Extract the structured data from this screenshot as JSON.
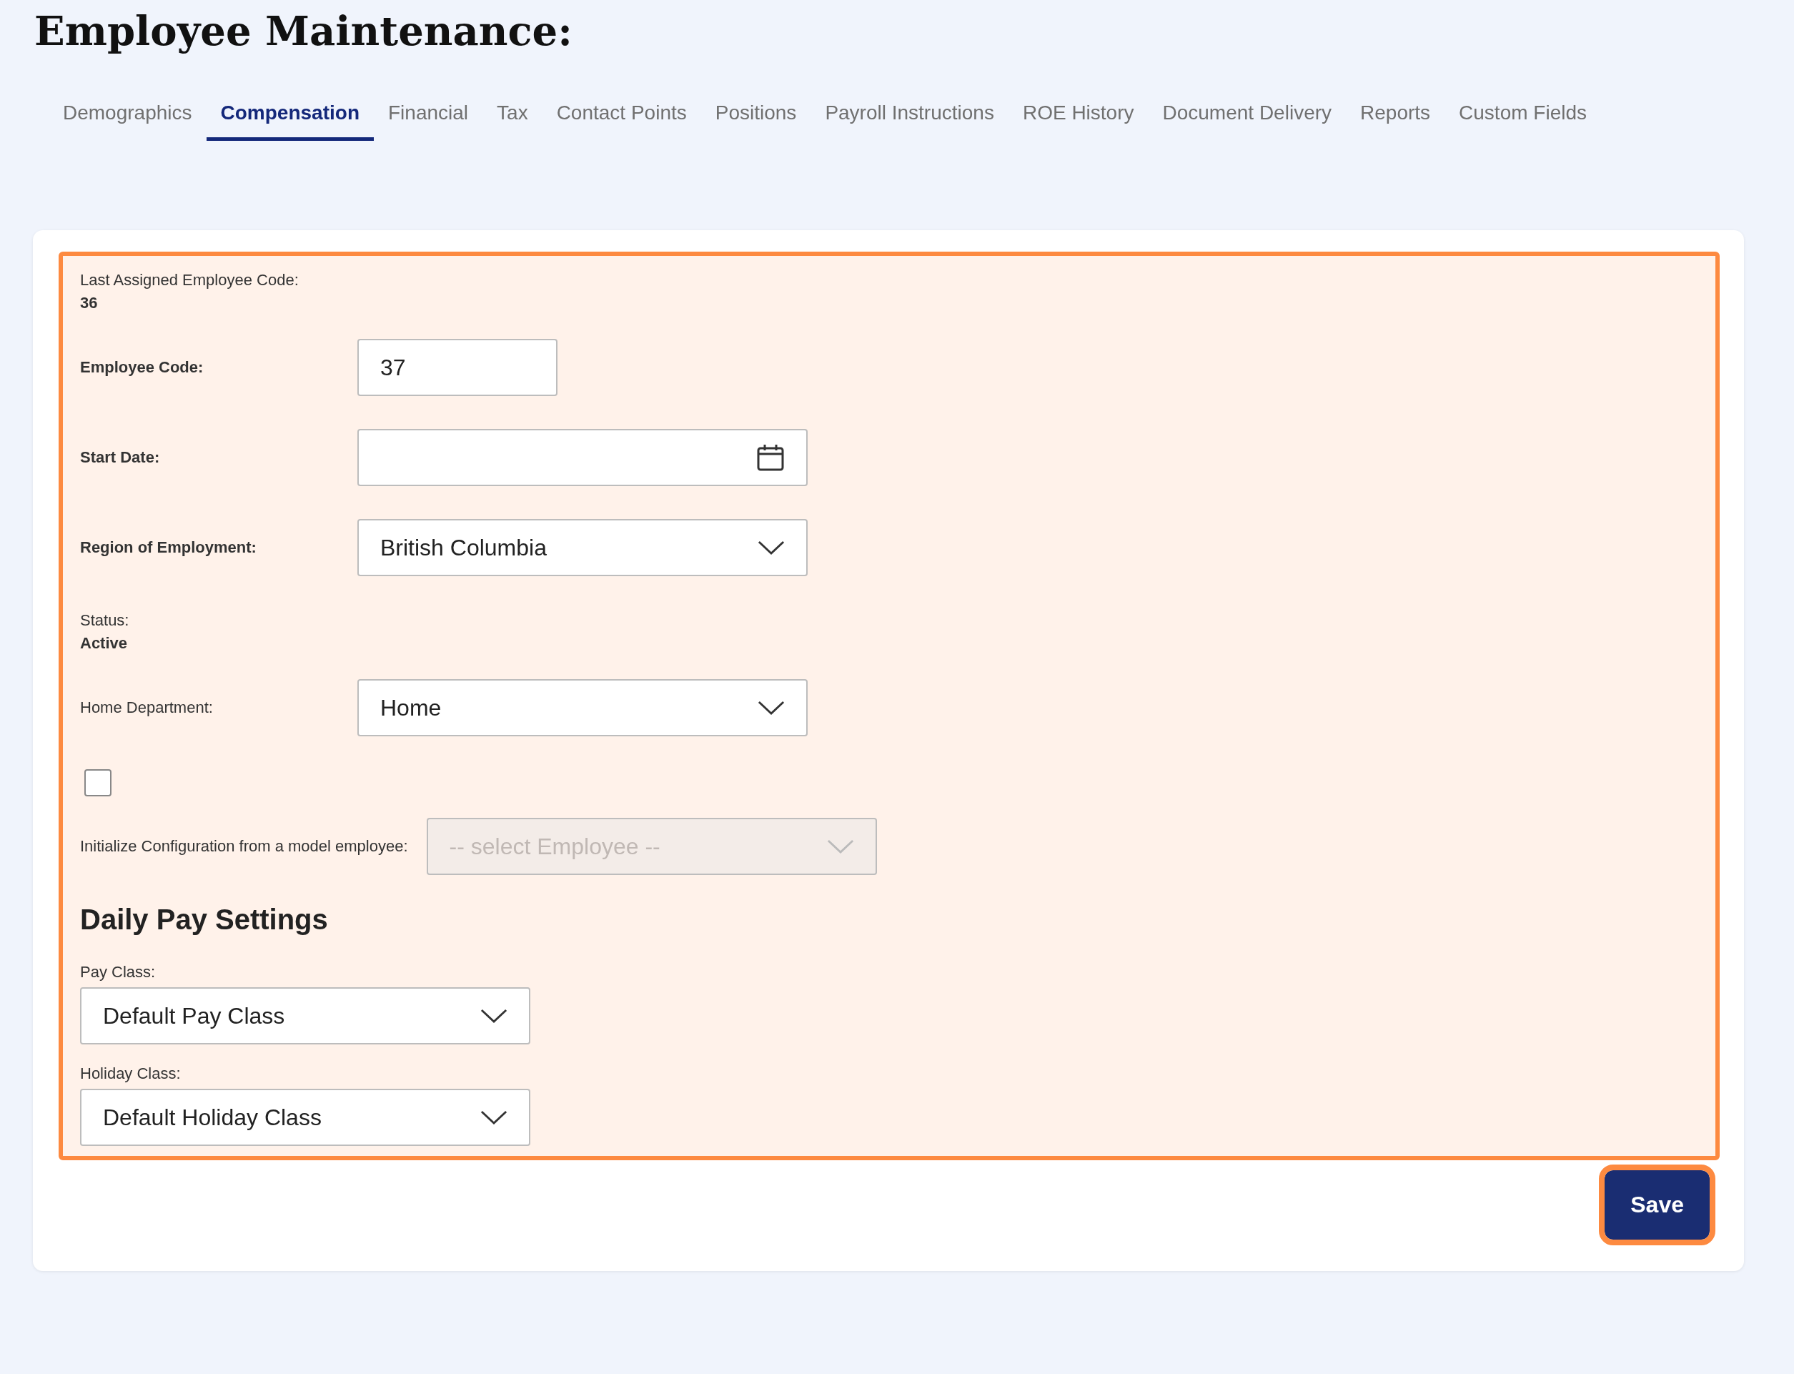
{
  "title": "Employee Maintenance:",
  "tabs": [
    {
      "label": "Demographics",
      "selected": false
    },
    {
      "label": "Compensation",
      "selected": true
    },
    {
      "label": "Financial",
      "selected": false
    },
    {
      "label": "Tax",
      "selected": false
    },
    {
      "label": "Contact Points",
      "selected": false
    },
    {
      "label": "Positions",
      "selected": false
    },
    {
      "label": "Payroll Instructions",
      "selected": false
    },
    {
      "label": "ROE History",
      "selected": false
    },
    {
      "label": "Document Delivery",
      "selected": false
    },
    {
      "label": "Reports",
      "selected": false
    },
    {
      "label": "Custom Fields",
      "selected": false
    }
  ],
  "form": {
    "highlighted": true,
    "fields": [
      {
        "kind": "info",
        "label": "Last Assigned Employee Code:",
        "value": "36"
      },
      {
        "kind": "text",
        "label": "Employee Code:",
        "bold": true,
        "value": "37"
      },
      {
        "kind": "date",
        "label": "Start Date:",
        "bold": true
      },
      {
        "kind": "select",
        "label": "Region of Employment:",
        "bold": true,
        "value": "British Columbia"
      },
      {
        "kind": "info",
        "label": "Status:",
        "value": "Active"
      },
      {
        "kind": "select",
        "label": "Home Department:",
        "bold": false,
        "value": "Home"
      },
      {
        "kind": "model",
        "checked": false,
        "label": "Initialize Configuration from a model employee:",
        "disabled": true,
        "placeholder": "-- select Employee --"
      }
    ],
    "section_heading": "Daily Pay Settings",
    "stacked_fields": [
      {
        "label": "Pay Class:",
        "value": "Default Pay Class"
      },
      {
        "label": "Holiday Class:",
        "value": "Default Holiday Class"
      }
    ]
  },
  "save_button": {
    "label": "Save",
    "highlighted": true
  }
}
